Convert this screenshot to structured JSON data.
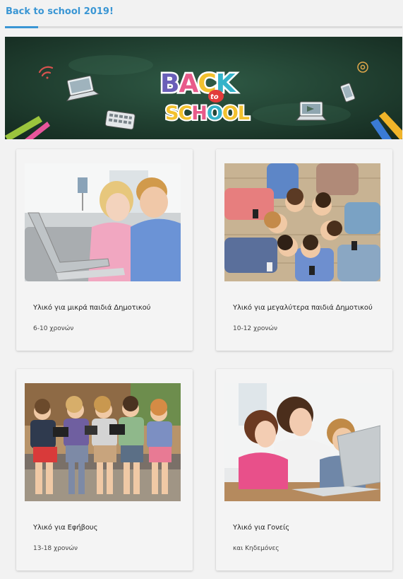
{
  "page": {
    "title": "Back to school 2019!"
  },
  "hero": {
    "banner_word_1": "BACK",
    "banner_word_2": "to",
    "banner_word_3": "SCHOOL",
    "icons": [
      "wifi-icon",
      "laptop-icon",
      "keyboard-icon",
      "laptop-icon",
      "smartphone-icon",
      "at-sign-icon",
      "pencil-icon"
    ]
  },
  "cards": [
    {
      "title": "Υλικό για μικρά παιδιά Δημοτικού",
      "subtitle": "6-10 χρονών",
      "image": "two young children using a laptop on a sofa"
    },
    {
      "title": "Υλικό για μεγαλύτερα παιδιά Δημοτικού",
      "subtitle": "10-12 χρονών",
      "image": "children lying in a circle holding phones"
    },
    {
      "title": "Υλικό για Εφήβους",
      "subtitle": "13-18 χρονών",
      "image": "teenagers sitting on a bench with devices"
    },
    {
      "title": "Υλικό για Γονείς",
      "subtitle": "και Κηδεμόνες",
      "image": "mother with two children at a laptop"
    }
  ],
  "colors": {
    "accent": "#3a96d4",
    "background": "#f2f2f2",
    "card": "#f4f4f4",
    "chalkboard": "#1d3a2e"
  }
}
